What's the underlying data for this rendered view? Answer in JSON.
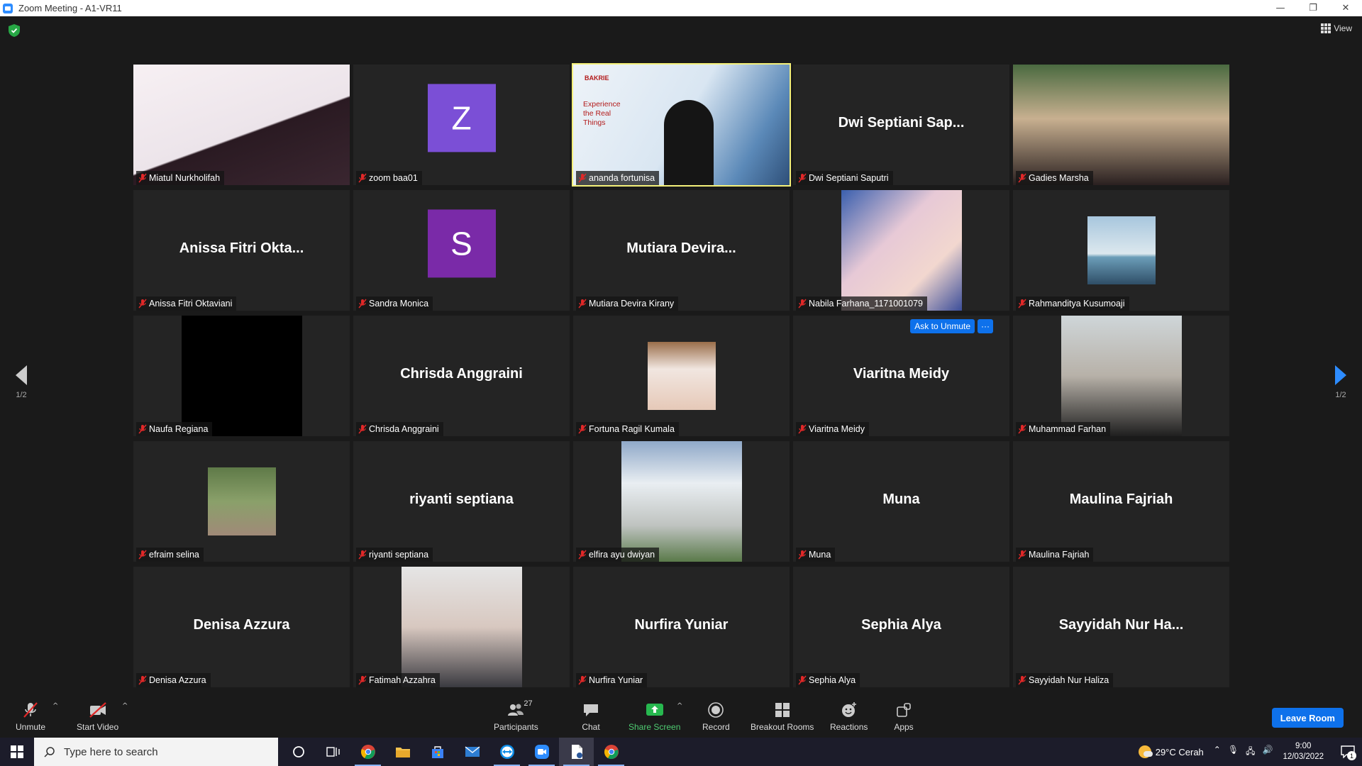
{
  "window": {
    "title": "Zoom Meeting - A1-VR11",
    "minimize": "—",
    "restore": "❐",
    "close": "✕"
  },
  "view_label": "View",
  "pager": {
    "left": "1/2",
    "right": "1/2"
  },
  "ask_to_unmute": "Ask to Unmute",
  "more_glyph": "···",
  "participants": [
    {
      "label": "Miatul Nurkholifah",
      "display": "video"
    },
    {
      "label": "zoom baa01",
      "display": "letter",
      "letter": "Z",
      "color": "#7b4fd6"
    },
    {
      "label": "ananda fortunisa",
      "display": "video",
      "active_speaker": true,
      "banner": "Experience the Real Things",
      "brand": "BAKRIE"
    },
    {
      "label": "Dwi Septiani Saputri",
      "display": "name",
      "big_name": "Dwi Septiani Sap..."
    },
    {
      "label": "Gadies Marsha",
      "display": "video"
    },
    {
      "label": "Anissa Fitri Oktaviani",
      "display": "name",
      "big_name": "Anissa Fitri Okta..."
    },
    {
      "label": "Sandra Monica",
      "display": "letter",
      "letter": "S",
      "color": "#7a2aa8"
    },
    {
      "label": "Mutiara Devira Kirany",
      "display": "name",
      "big_name": "Mutiara Devira..."
    },
    {
      "label": "Nabila Farhana_1171001079",
      "display": "video"
    },
    {
      "label": "Rahmanditya Kusumoaji",
      "display": "thumb"
    },
    {
      "label": "Naufa Regiana",
      "display": "black"
    },
    {
      "label": "Chrisda Anggraini",
      "display": "name",
      "big_name": "Chrisda Anggraini"
    },
    {
      "label": "Fortuna Ragil Kumala",
      "display": "thumb"
    },
    {
      "label": "Viaritna Meidy",
      "display": "name",
      "big_name": "Viaritna Meidy",
      "ask_unmute": true
    },
    {
      "label": "Muhammad Farhan",
      "display": "video"
    },
    {
      "label": "efraim selina",
      "display": "thumb"
    },
    {
      "label": "riyanti septiana",
      "display": "name",
      "big_name": "riyanti septiana"
    },
    {
      "label": "elfira ayu dwiyan",
      "display": "video"
    },
    {
      "label": "Muna",
      "display": "name",
      "big_name": "Muna"
    },
    {
      "label": "Maulina Fajriah",
      "display": "name",
      "big_name": "Maulina Fajriah"
    },
    {
      "label": "Denisa Azzura",
      "display": "name",
      "big_name": "Denisa Azzura"
    },
    {
      "label": "Fatimah Azzahra",
      "display": "video"
    },
    {
      "label": "Nurfira Yuniar",
      "display": "name",
      "big_name": "Nurfira Yuniar"
    },
    {
      "label": "Sephia Alya",
      "display": "name",
      "big_name": "Sephia Alya"
    },
    {
      "label": "Sayyidah Nur Haliza",
      "display": "name",
      "big_name": "Sayyidah Nur Ha..."
    }
  ],
  "toolbar": {
    "unmute": "Unmute",
    "start_video": "Start Video",
    "participants": "Participants",
    "participants_count": "27",
    "chat": "Chat",
    "share_screen": "Share Screen",
    "record": "Record",
    "breakout_rooms": "Breakout Rooms",
    "reactions": "Reactions",
    "apps": "Apps",
    "leave": "Leave Room",
    "caret": "^"
  },
  "taskbar": {
    "search_placeholder": "Type here to search",
    "weather": "29°C  Cerah",
    "time": "9:00",
    "date": "12/03/2022",
    "notification_count": "1"
  },
  "colors": {
    "accent": "#0e71eb",
    "share_green": "#4ecb71",
    "active_border": "#f4f07a",
    "mute_red": "#e02828"
  }
}
